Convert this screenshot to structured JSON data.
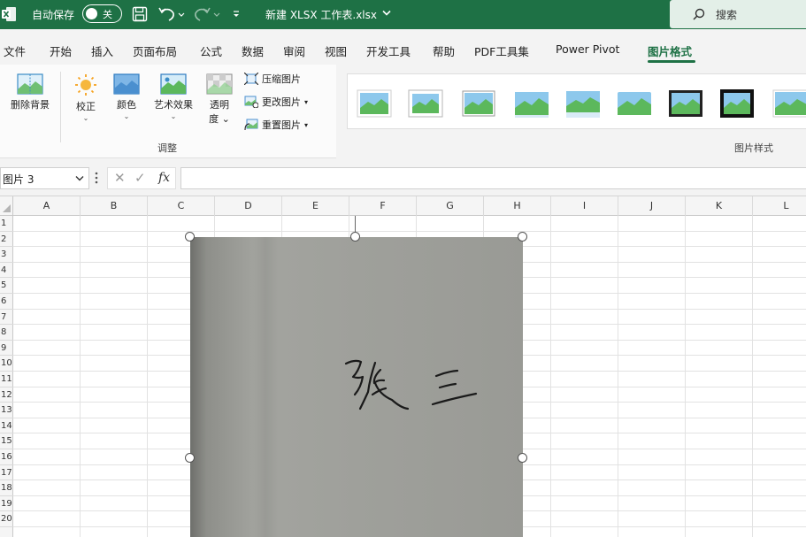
{
  "titlebar": {
    "autosave_label": "自动保存",
    "autosave_state": "关",
    "document_title": "新建 XLSX 工作表.xlsx",
    "search_placeholder": "搜索",
    "brand_color": "#1e7145"
  },
  "menu": {
    "tabs": [
      "文件",
      "开始",
      "插入",
      "页面布局",
      "公式",
      "数据",
      "审阅",
      "视图",
      "开发工具",
      "帮助",
      "PDF工具集",
      "Power Pivot",
      "图片格式"
    ],
    "active_tab": "图片格式"
  },
  "ribbon": {
    "remove_background": "删除背景",
    "corrections": "校正",
    "color": "颜色",
    "artistic_effects": "艺术效果",
    "transparency_line1": "透明",
    "transparency_line2": "度",
    "compress_pictures": "压缩图片",
    "change_picture": "更改图片",
    "reset_picture": "重置图片",
    "group_adjust": "调整",
    "group_picture_styles": "图片样式",
    "style_count_visible": 9
  },
  "formula_bar": {
    "name_box": "图片 3",
    "cancel_symbol": "✕",
    "enter_symbol": "✓",
    "fx_label": "fx",
    "formula_value": ""
  },
  "sheet": {
    "columns": [
      "A",
      "B",
      "C",
      "D",
      "E",
      "F",
      "G",
      "H",
      "I",
      "J",
      "K",
      "L"
    ],
    "rows": [
      "1",
      "2",
      "3",
      "4",
      "5",
      "6",
      "7",
      "8",
      "9",
      "10",
      "11",
      "12",
      "13",
      "14",
      "15",
      "16",
      "17",
      "18",
      "19",
      "20"
    ]
  },
  "picture": {
    "content_text": "张三",
    "paper_color": "#9c9d98"
  }
}
